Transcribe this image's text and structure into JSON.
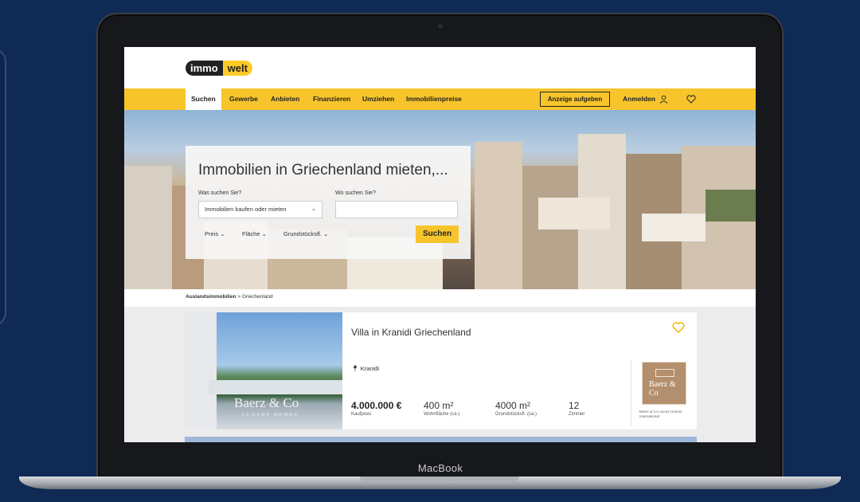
{
  "device": {
    "label": "MacBook"
  },
  "site": {
    "logo_part1": "immo",
    "logo_part2": "welt"
  },
  "nav": {
    "items": [
      "Suchen",
      "Gewerbe",
      "Anbieten",
      "Finanzieren",
      "Umziehen",
      "Immobilienpreise"
    ],
    "post_ad": "Anzeige aufgeben",
    "login": "Anmelden"
  },
  "search": {
    "title": "Immobilien in Griechenland mieten,...",
    "what_label": "Was suchen Sie?",
    "what_value": "Immobilien kaufen oder mieten",
    "where_label": "Wo suchen Sie?",
    "where_value": "",
    "filters": [
      "Preis",
      "Fläche",
      "Grundstücksfl."
    ],
    "button": "Suchen"
  },
  "breadcrumb": {
    "root": "Auslandsimmobilien",
    "separator": ">",
    "current": "Griechenland"
  },
  "listing": {
    "title": "Villa in Kranidi Griechenland",
    "location": "Kranidi",
    "price": "4.000.000 €",
    "price_label": "Kaufpreis",
    "living_area": "400 m²",
    "living_area_label": "Wohnfläche (ca.)",
    "plot_area": "4000 m²",
    "plot_area_label": "Grundstücksfl. (ca.)",
    "rooms": "12",
    "rooms_label": "Zimmer",
    "image_brand": "Baerz & Co",
    "image_brand_sub": "LUXURY HOMES",
    "agent_logo_text": "Baerz & Co",
    "agent_name": "Baerz & Co Luxury Homes International"
  },
  "colors": {
    "background": "#0f2a55",
    "accent": "#f7c52b",
    "text": "#222222"
  },
  "icons": [
    "user-icon",
    "heart-icon",
    "location-pin-icon",
    "chevron-down-icon"
  ]
}
